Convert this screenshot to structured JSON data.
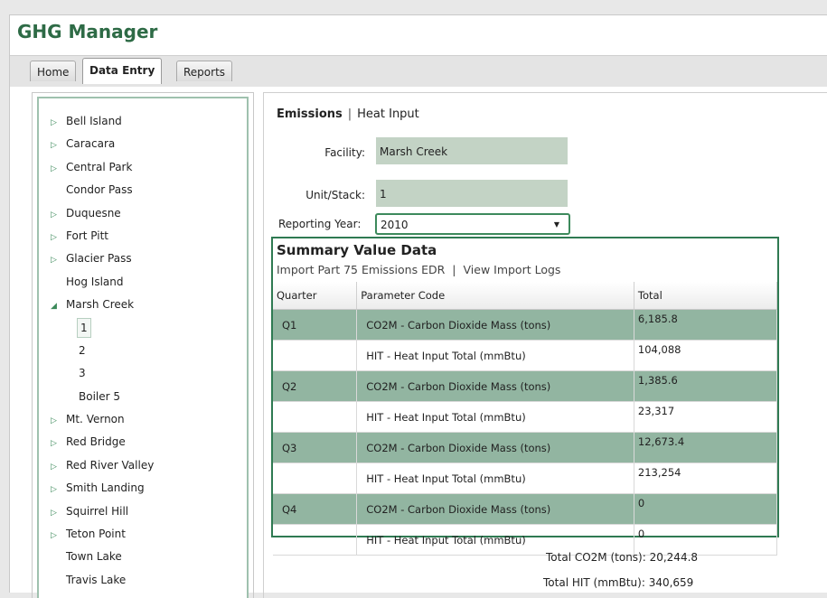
{
  "app": {
    "title": "GHG Manager"
  },
  "tabs": [
    {
      "label": "Home"
    },
    {
      "label": "Data Entry"
    },
    {
      "label": "Reports"
    }
  ],
  "tree": {
    "facilities": [
      {
        "label": "Bell Island",
        "state": "collapsed"
      },
      {
        "label": "Caracara",
        "state": "collapsed"
      },
      {
        "label": "Central Park",
        "state": "collapsed"
      },
      {
        "label": "Condor Pass",
        "state": "leaf"
      },
      {
        "label": "Duquesne",
        "state": "collapsed"
      },
      {
        "label": "Fort Pitt",
        "state": "collapsed"
      },
      {
        "label": "Glacier Pass",
        "state": "collapsed"
      },
      {
        "label": "Hog Island",
        "state": "leaf"
      },
      {
        "label": "Marsh Creek",
        "state": "expanded"
      },
      {
        "label": "Mt. Vernon",
        "state": "collapsed"
      },
      {
        "label": "Red Bridge",
        "state": "collapsed"
      },
      {
        "label": "Red River Valley",
        "state": "collapsed"
      },
      {
        "label": "Smith Landing",
        "state": "collapsed"
      },
      {
        "label": "Squirrel Hill",
        "state": "collapsed"
      },
      {
        "label": "Teton Point",
        "state": "collapsed"
      },
      {
        "label": "Town Lake",
        "state": "leaf"
      },
      {
        "label": "Travis Lake",
        "state": "leaf"
      }
    ],
    "marsh_creek_units": [
      "1",
      "2",
      "3",
      "Boiler 5"
    ],
    "selected_unit": "1"
  },
  "subnav": {
    "emissions": "Emissions",
    "separator": "|",
    "heat_input": "Heat Input"
  },
  "form": {
    "facility_label": "Facility:",
    "facility_value": "Marsh Creek",
    "unit_label": "Unit/Stack:",
    "unit_value": "1",
    "year_label": "Reporting Year:",
    "year_value": "2010"
  },
  "summary": {
    "title": "Summary Value Data",
    "import_link": "Import Part 75 Emissions EDR",
    "link_separator": "|",
    "logs_link": "View Import Logs",
    "columns": [
      "Quarter",
      "Parameter Code",
      "Total"
    ],
    "rows": [
      {
        "quarter": "Q1",
        "parameter": "CO2M - Carbon Dioxide Mass (tons)",
        "total": "6,185.8"
      },
      {
        "quarter": "",
        "parameter": "HIT - Heat Input Total (mmBtu)",
        "total": "104,088"
      },
      {
        "quarter": "Q2",
        "parameter": "CO2M - Carbon Dioxide Mass (tons)",
        "total": "1,385.6"
      },
      {
        "quarter": "",
        "parameter": "HIT - Heat Input Total (mmBtu)",
        "total": "23,317"
      },
      {
        "quarter": "Q3",
        "parameter": "CO2M - Carbon Dioxide Mass (tons)",
        "total": "12,673.4"
      },
      {
        "quarter": "",
        "parameter": "HIT - Heat Input Total (mmBtu)",
        "total": "213,254"
      },
      {
        "quarter": "Q4",
        "parameter": "CO2M - Carbon Dioxide Mass (tons)",
        "total": "0"
      },
      {
        "quarter": "",
        "parameter": "HIT - Heat Input Total (mmBtu)",
        "total": "0"
      }
    ],
    "total_co2m": "Total CO2M (tons): 20,244.8",
    "total_hit": "Total HIT (mmBtu): 340,659"
  },
  "colors": {
    "brand": "#2e6b46",
    "row_shade": "#92b5a1",
    "field_bg": "#c3d3c5",
    "accent_border": "#2f7a52"
  },
  "icons": {
    "collapsed": "triangle-right-icon",
    "expanded": "triangle-down-icon",
    "dropdown": "chevron-down-icon"
  }
}
